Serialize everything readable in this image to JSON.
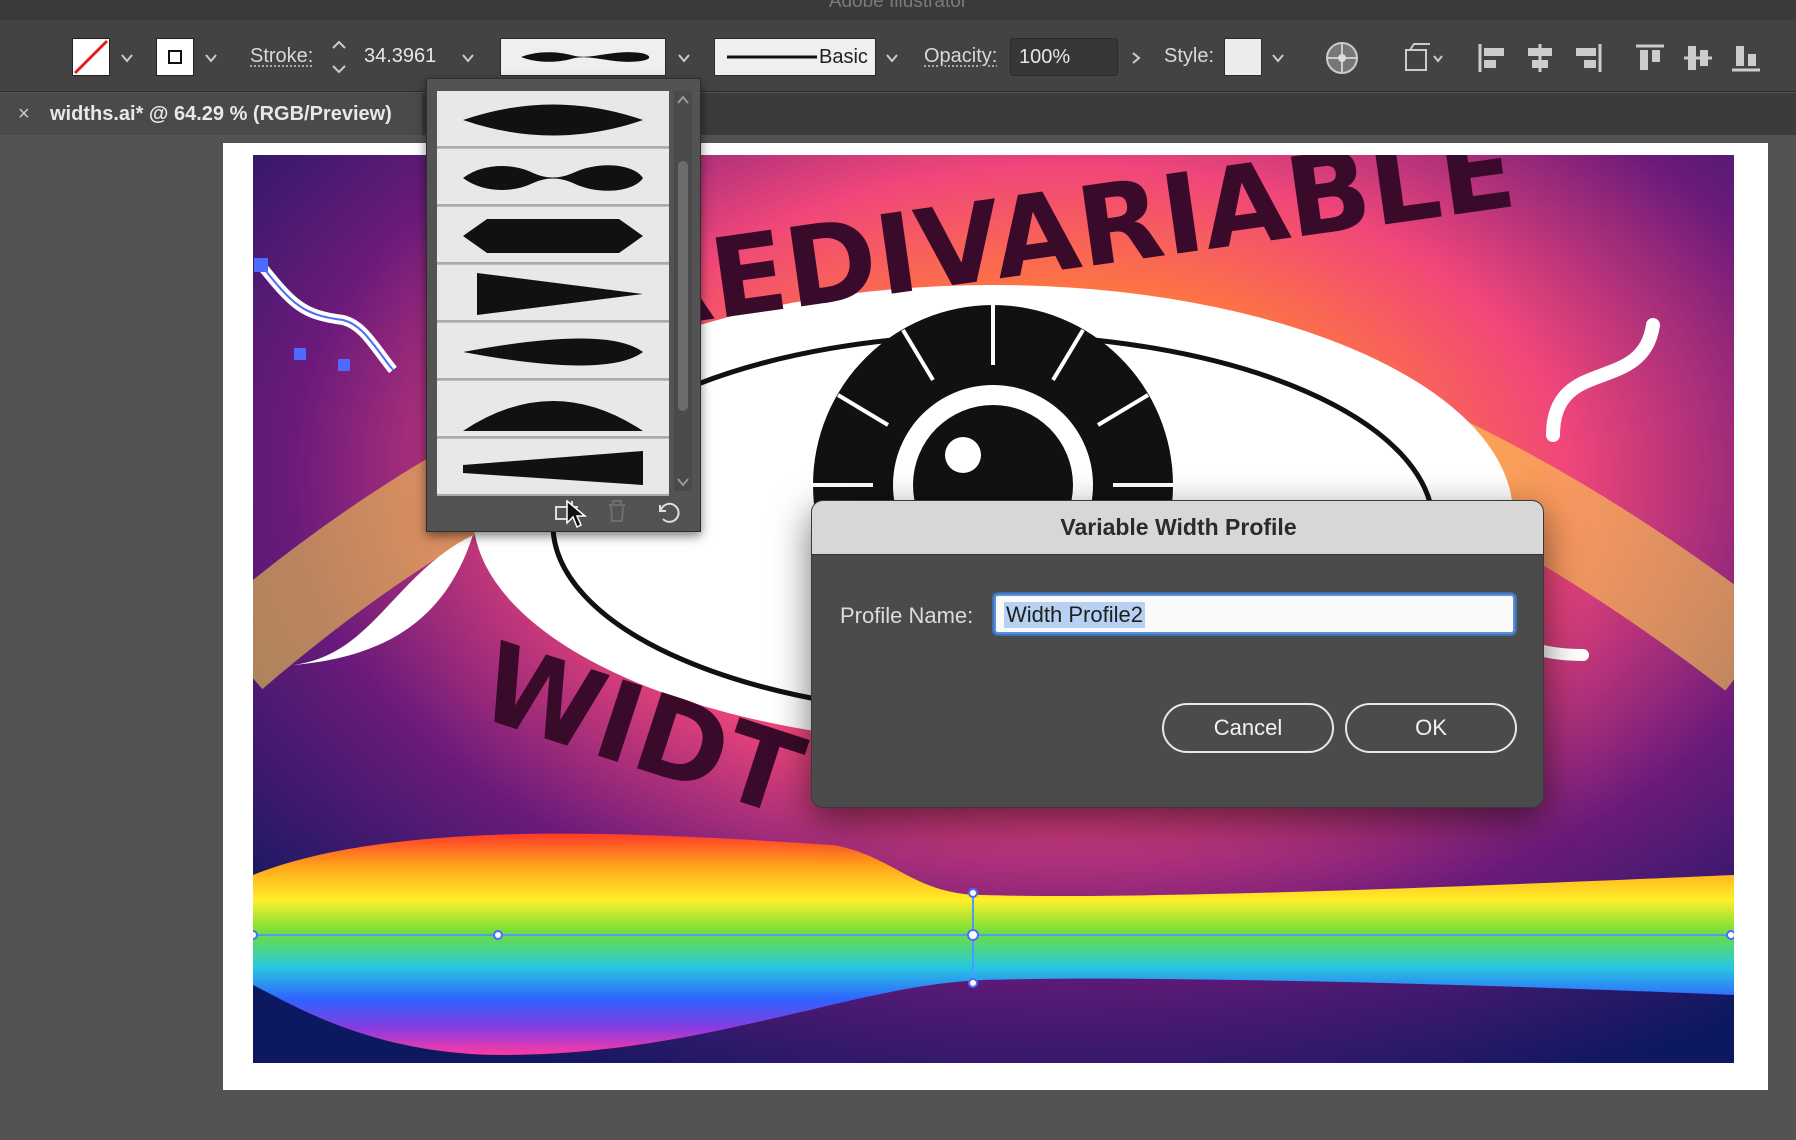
{
  "window": {
    "title": "Adobe Illustrator"
  },
  "control_bar": {
    "stroke_label": "Stroke:",
    "stroke_value": "34.3961",
    "brush_label": "Basic",
    "opacity_label": "Opacity:",
    "opacity_value": "100%",
    "style_label": "Style:"
  },
  "document_tab": {
    "close_symbol": "×",
    "name": "widths.ai* @ 64.29 % (RGB/Preview)"
  },
  "profiles_popup": {
    "items": [
      "width-profile-1-icon",
      "width-profile-2-icon",
      "width-profile-3-icon",
      "width-profile-4-icon",
      "width-profile-5-icon",
      "width-profile-6-icon",
      "width-profile-7-icon"
    ]
  },
  "artwork": {
    "headline_top": "REDIVARIABLE",
    "headline_bottom": "WIDT"
  },
  "dialog": {
    "title": "Variable Width Profile",
    "profile_name_label": "Profile Name:",
    "profile_name_value": "Width Profile2",
    "cancel_label": "Cancel",
    "ok_label": "OK"
  },
  "colors": {
    "accent": "#3f6fb5",
    "selection": "#4d6bff"
  }
}
